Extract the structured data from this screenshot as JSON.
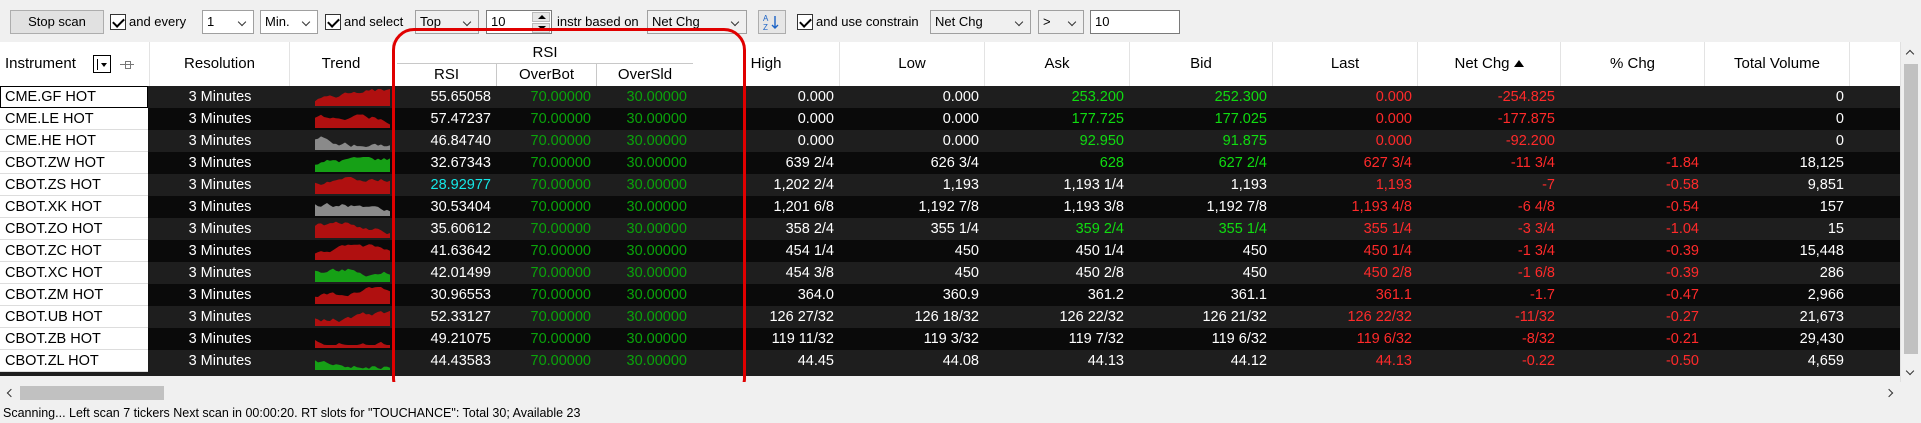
{
  "toolbar": {
    "stop_scan": "Stop scan",
    "and_every_label": "and every",
    "interval_value": "1",
    "unit_value": "Min.",
    "and_select_label": "and select",
    "select_mode": "Top",
    "count_value": "10",
    "instr_based_on_label": "instr based on",
    "based_on_value": "Net Chg",
    "and_use_constrain_label": "and use constrain",
    "constrain_field": "Net Chg",
    "constrain_operator": ">",
    "constrain_value": "10"
  },
  "grid": {
    "headers": {
      "instrument": "Instrument",
      "resolution": "Resolution",
      "trend": "Trend",
      "rsi_group": "RSI",
      "rsi": "RSI",
      "overbot": "OverBot",
      "oversld": "OverSld",
      "high": "High",
      "low": "Low",
      "ask": "Ask",
      "bid": "Bid",
      "last": "Last",
      "net_chg": "Net Chg",
      "pct_chg": "% Chg",
      "total_volume": "Total Volume"
    },
    "rows": [
      {
        "instrument": "CME.GF HOT",
        "resolution": "3 Minutes",
        "trend": "red",
        "rsi": "55.65058",
        "overbot": "70.00000",
        "oversld": "30.00000",
        "high": "0.000",
        "low": "0.000",
        "ask": "253.200",
        "bid": "252.300",
        "last": "0.000",
        "net_chg": "-254.825",
        "pct_chg": "",
        "volume": "0"
      },
      {
        "instrument": "CME.LE HOT",
        "resolution": "3 Minutes",
        "trend": "red",
        "rsi": "57.47237",
        "overbot": "70.00000",
        "oversld": "30.00000",
        "high": "0.000",
        "low": "0.000",
        "ask": "177.725",
        "bid": "177.025",
        "last": "0.000",
        "net_chg": "-177.875",
        "pct_chg": "",
        "volume": "0"
      },
      {
        "instrument": "CME.HE HOT",
        "resolution": "3 Minutes",
        "trend": "grey",
        "rsi": "46.84740",
        "overbot": "70.00000",
        "oversld": "30.00000",
        "high": "0.000",
        "low": "0.000",
        "ask": "92.950",
        "bid": "91.875",
        "last": "0.000",
        "net_chg": "-92.200",
        "pct_chg": "",
        "volume": "0"
      },
      {
        "instrument": "CBOT.ZW HOT",
        "resolution": "3 Minutes",
        "trend": "green",
        "rsi": "32.67343",
        "overbot": "70.00000",
        "oversld": "30.00000",
        "high": "639 2/4",
        "low": "626 3/4",
        "ask": "628",
        "bid": "627 2/4",
        "last": "627 3/4",
        "net_chg": "-11 3/4",
        "pct_chg": "-1.84",
        "volume": "18,125"
      },
      {
        "instrument": "CBOT.ZS HOT",
        "resolution": "3 Minutes",
        "trend": "red",
        "rsi": "28.92977",
        "overbot": "70.00000",
        "oversld": "30.00000",
        "high": "1,202 2/4",
        "low": "1,193",
        "ask": "1,193 1/4",
        "bid": "1,193",
        "last": "1,193",
        "net_chg": "-7",
        "pct_chg": "-0.58",
        "volume": "9,851"
      },
      {
        "instrument": "CBOT.XK HOT",
        "resolution": "3 Minutes",
        "trend": "grey",
        "rsi": "30.53404",
        "overbot": "70.00000",
        "oversld": "30.00000",
        "high": "1,201 6/8",
        "low": "1,192 7/8",
        "ask": "1,193 3/8",
        "bid": "1,192 7/8",
        "last": "1,193 4/8",
        "net_chg": "-6 4/8",
        "pct_chg": "-0.54",
        "volume": "157"
      },
      {
        "instrument": "CBOT.ZO HOT",
        "resolution": "3 Minutes",
        "trend": "red",
        "rsi": "35.60612",
        "overbot": "70.00000",
        "oversld": "30.00000",
        "high": "358 2/4",
        "low": "355 1/4",
        "ask": "359 2/4",
        "bid": "355 1/4",
        "last": "355 1/4",
        "net_chg": "-3 3/4",
        "pct_chg": "-1.04",
        "volume": "15"
      },
      {
        "instrument": "CBOT.ZC HOT",
        "resolution": "3 Minutes",
        "trend": "red",
        "rsi": "41.63642",
        "overbot": "70.00000",
        "oversld": "30.00000",
        "high": "454 1/4",
        "low": "450",
        "ask": "450 1/4",
        "bid": "450",
        "last": "450 1/4",
        "net_chg": "-1 3/4",
        "pct_chg": "-0.39",
        "volume": "15,448"
      },
      {
        "instrument": "CBOT.XC HOT",
        "resolution": "3 Minutes",
        "trend": "green",
        "rsi": "42.01499",
        "overbot": "70.00000",
        "oversld": "30.00000",
        "high": "454 3/8",
        "low": "450",
        "ask": "450 2/8",
        "bid": "450",
        "last": "450 2/8",
        "net_chg": "-1 6/8",
        "pct_chg": "-0.39",
        "volume": "286"
      },
      {
        "instrument": "CBOT.ZM HOT",
        "resolution": "3 Minutes",
        "trend": "red",
        "rsi": "30.96553",
        "overbot": "70.00000",
        "oversld": "30.00000",
        "high": "364.0",
        "low": "360.9",
        "ask": "361.2",
        "bid": "361.1",
        "last": "361.1",
        "net_chg": "-1.7",
        "pct_chg": "-0.47",
        "volume": "2,966"
      },
      {
        "instrument": "CBOT.UB HOT",
        "resolution": "3 Minutes",
        "trend": "red",
        "rsi": "52.33127",
        "overbot": "70.00000",
        "oversld": "30.00000",
        "high": "126 27/32",
        "low": "126 18/32",
        "ask": "126 22/32",
        "bid": "126 21/32",
        "last": "126 22/32",
        "net_chg": "-11/32",
        "pct_chg": "-0.27",
        "volume": "21,673"
      },
      {
        "instrument": "CBOT.ZB HOT",
        "resolution": "3 Minutes",
        "trend": "red",
        "rsi": "49.21075",
        "overbot": "70.00000",
        "oversld": "30.00000",
        "high": "119 11/32",
        "low": "119 3/32",
        "ask": "119 7/32",
        "bid": "119 6/32",
        "last": "119 6/32",
        "net_chg": "-8/32",
        "pct_chg": "-0.21",
        "volume": "29,430"
      },
      {
        "instrument": "CBOT.ZL HOT",
        "resolution": "3 Minutes",
        "trend": "green",
        "rsi": "44.43583",
        "overbot": "70.00000",
        "oversld": "30.00000",
        "high": "44.45",
        "low": "44.08",
        "ask": "44.13",
        "bid": "44.12",
        "last": "44.13",
        "net_chg": "-0.22",
        "pct_chg": "-0.50",
        "volume": "4,659"
      }
    ]
  },
  "colors": {
    "up": "#10dc10",
    "down": "#ff2a2a",
    "oversold_highlight": "#15e8e8",
    "band": "#0aa30a",
    "trend_red": "#b01010",
    "trend_green": "#16a016",
    "trend_grey": "#8a8a8a",
    "annotation": "#e00000"
  },
  "status": "Scanning... Left scan 7 tickers Next scan in 00:00:20. RT slots for \"TOUCHANCE\": Total 30; Available 23"
}
